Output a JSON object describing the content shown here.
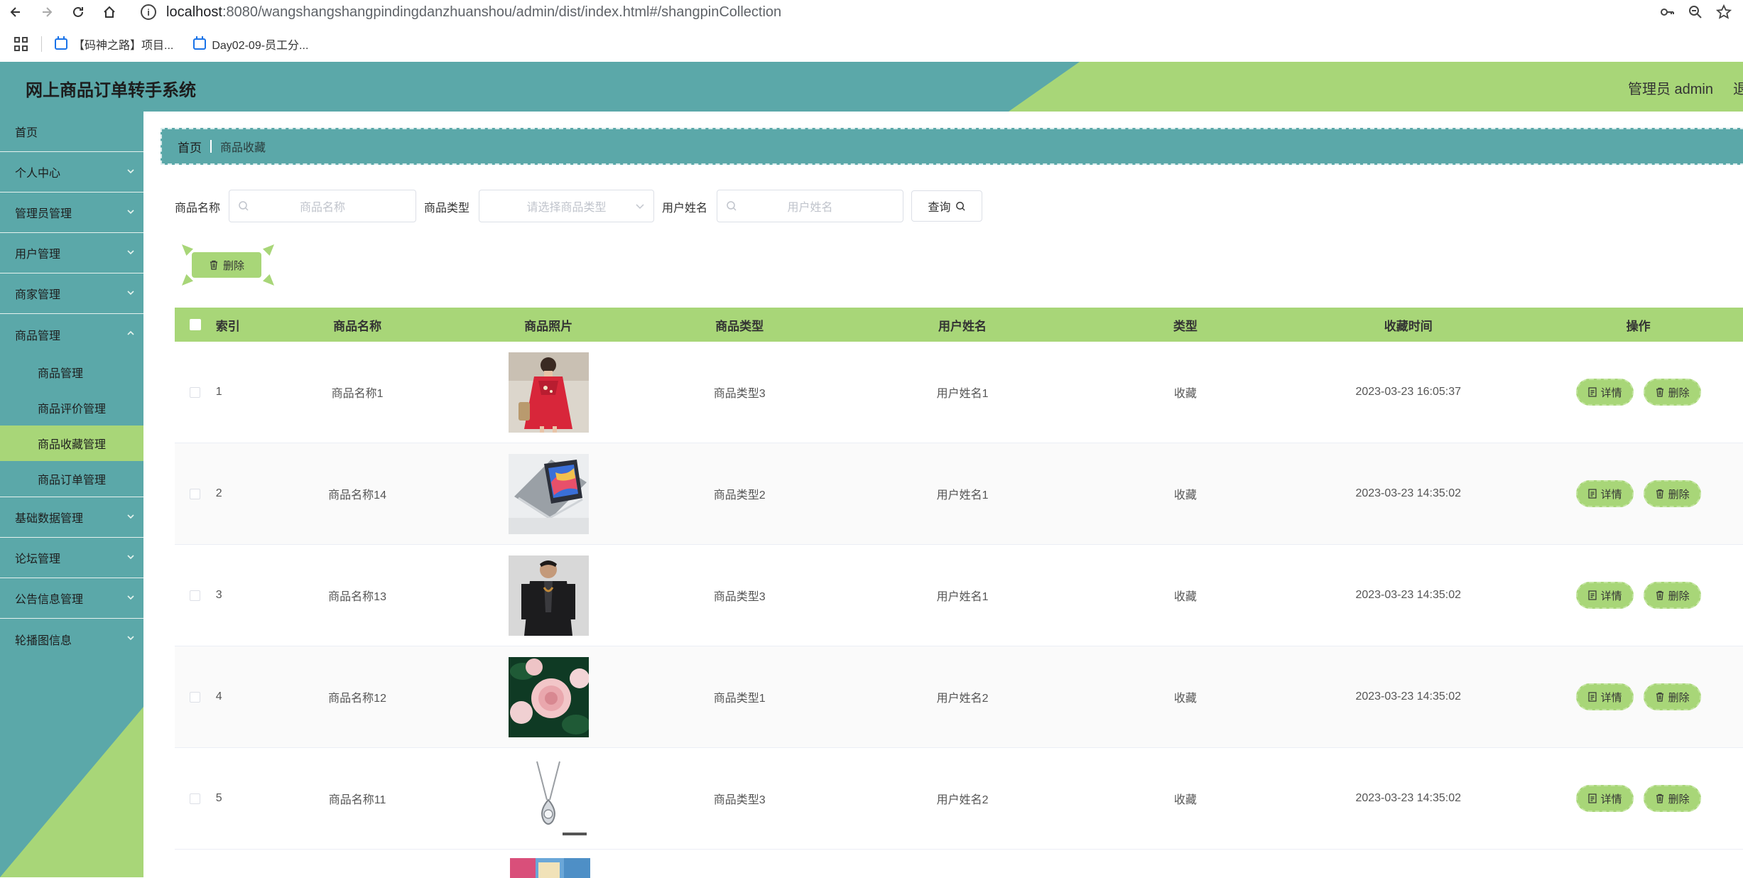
{
  "browser": {
    "url_host": "localhost",
    "url_path": ":8080/wangshangshangpindingdanzhuanshou/admin/dist/index.html#/shangpinCollection",
    "bookmarks": [
      {
        "label": "【码神之路】项目..."
      },
      {
        "label": "Day02-09-员工分..."
      }
    ]
  },
  "header": {
    "title": "网上商品订单转手系统",
    "admin_label": "管理员 admin",
    "logout_label": "退"
  },
  "sidebar": {
    "items": [
      {
        "label": "首页"
      },
      {
        "label": "个人中心"
      },
      {
        "label": "管理员管理"
      },
      {
        "label": "用户管理"
      },
      {
        "label": "商家管理"
      },
      {
        "label": "商品管理"
      },
      {
        "label": "基础数据管理"
      },
      {
        "label": "论坛管理"
      },
      {
        "label": "公告信息管理"
      },
      {
        "label": "轮播图信息"
      }
    ],
    "sub_items": [
      {
        "label": "商品管理"
      },
      {
        "label": "商品评价管理"
      },
      {
        "label": "商品收藏管理"
      },
      {
        "label": "商品订单管理"
      }
    ]
  },
  "breadcrumb": {
    "home": "首页",
    "current": "商品收藏"
  },
  "search": {
    "name_label": "商品名称",
    "name_placeholder": "商品名称",
    "type_label": "商品类型",
    "type_placeholder": "请选择商品类型",
    "user_label": "用户姓名",
    "user_placeholder": "用户姓名",
    "query_label": "查询"
  },
  "toolbar": {
    "delete_label": "删除"
  },
  "table": {
    "headers": [
      "索引",
      "商品名称",
      "商品照片",
      "商品类型",
      "用户姓名",
      "类型",
      "收藏时间",
      "操作"
    ],
    "detail_label": "详情",
    "delete_label": "删除",
    "rows": [
      {
        "idx": "1",
        "name": "商品名称1",
        "image": "red-dress-photo",
        "type": "商品类型3",
        "user": "用户姓名1",
        "kind": "收藏",
        "time": "2023-03-23 16:05:37"
      },
      {
        "idx": "2",
        "name": "商品名称14",
        "image": "laptop-photo",
        "type": "商品类型2",
        "user": "用户姓名1",
        "kind": "收藏",
        "time": "2023-03-23 14:35:02"
      },
      {
        "idx": "3",
        "name": "商品名称13",
        "image": "jacket-photo",
        "type": "商品类型3",
        "user": "用户姓名1",
        "kind": "收藏",
        "time": "2023-03-23 14:35:02"
      },
      {
        "idx": "4",
        "name": "商品名称12",
        "image": "roses-photo",
        "type": "商品类型1",
        "user": "用户姓名2",
        "kind": "收藏",
        "time": "2023-03-23 14:35:02"
      },
      {
        "idx": "5",
        "name": "商品名称11",
        "image": "necklace-photo",
        "type": "商品类型3",
        "user": "用户姓名2",
        "kind": "收藏",
        "time": "2023-03-23 14:35:02"
      }
    ]
  },
  "colors": {
    "teal": "#5ba8a9",
    "green": "#a8d678"
  }
}
